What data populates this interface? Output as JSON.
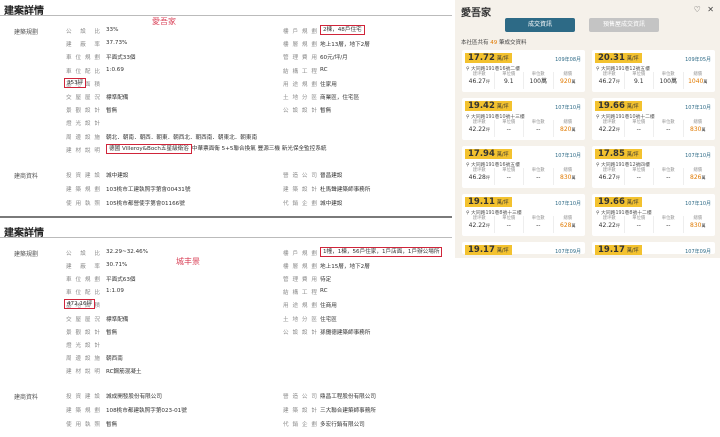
{
  "section1": {
    "title": "建案詳情",
    "group_plan": "建築規劃",
    "group_info": "建商資料",
    "watermark": "愛吾家",
    "left_rows": [
      {
        "label": "公設比",
        "value": "33%"
      },
      {
        "label": "建蔽率",
        "value": "37.73%"
      },
      {
        "label": "車位規劃",
        "value": "平面式33個"
      },
      {
        "label": "車位配比",
        "value": "1:0.69"
      },
      {
        "label": "基地面積",
        "value": "353坪",
        "highlight": true
      },
      {
        "label": "交屋屋況",
        "value": "標準配備"
      },
      {
        "label": "景觀設計",
        "value": "暫無"
      },
      {
        "label": "燈光設計",
        "value": ""
      },
      {
        "label": "周邊設施",
        "value": "朝北．朝南．朝西．朝東．朝西北．朝西南．朝東北．朝東南"
      },
      {
        "label": "建材說明",
        "value": "德國 Villeroy&Boch五星級衛浴",
        "highlight": true,
        "extra": "中華票面衛 5+5聯合換氣 豐源三機 新光保全監控系統"
      }
    ],
    "right_rows": [
      {
        "label": "樓戶規劃",
        "value": "2棟，48戶住宅",
        "highlight": true
      },
      {
        "label": "樓層規劃",
        "value": "地上13層，地下2層"
      },
      {
        "label": "管理費用",
        "value": "60元/坪/月"
      },
      {
        "label": "結構工程",
        "value": "RC"
      },
      {
        "label": "用途規劃",
        "value": "住家用"
      },
      {
        "label": "土地分區",
        "value": "商業區，住宅區"
      },
      {
        "label": "公設設計",
        "value": "暫無"
      }
    ],
    "info_left": [
      {
        "label": "投資建設",
        "value": "城中建設"
      },
      {
        "label": "建築規劃",
        "value": "103桃市工建執照字第會00431號"
      },
      {
        "label": "使用執照",
        "value": "105桃市都營使字第會01166號"
      }
    ],
    "info_right": [
      {
        "label": "營造公司",
        "value": "晉昌建設"
      },
      {
        "label": "建築設計",
        "value": "杜馬聲建築師事務所"
      },
      {
        "label": "代銷企劃",
        "value": "城中建設"
      }
    ]
  },
  "section2": {
    "title": "建案詳情",
    "group_plan": "建築規劃",
    "group_info": "建商資料",
    "watermark": "城丰景",
    "left_rows": [
      {
        "label": "公設比",
        "value": "32.29~32.46%"
      },
      {
        "label": "建蔽率",
        "value": "30.71%"
      },
      {
        "label": "車位規劃",
        "value": "平面式63個"
      },
      {
        "label": "車位配比",
        "value": "1:1.09"
      },
      {
        "label": "基地面積",
        "value": "472.16坪",
        "highlight": true
      },
      {
        "label": "交屋屋況",
        "value": "標準配備"
      },
      {
        "label": "景觀設計",
        "value": "暫無"
      },
      {
        "label": "燈光設計",
        "value": ""
      },
      {
        "label": "周邊設施",
        "value": "朝西南"
      },
      {
        "label": "建材說明",
        "value": "RC鋼筋混凝土"
      }
    ],
    "right_rows": [
      {
        "label": "樓戶規劃",
        "value": "1幢，1棟，56戶住家，1戶店面，1戶辦公場所",
        "highlight": true
      },
      {
        "label": "樓層規劃",
        "value": "地上15層，地下2層"
      },
      {
        "label": "管理費用",
        "value": "待定"
      },
      {
        "label": "結構工程",
        "value": "RC"
      },
      {
        "label": "用途規劃",
        "value": "住商用"
      },
      {
        "label": "土地分區",
        "value": "住宅區"
      },
      {
        "label": "公設設計",
        "value": "孫攤德建築師事務所"
      }
    ],
    "info_left": [
      {
        "label": "投資建設",
        "value": "城成開發股份有限公司"
      },
      {
        "label": "建築規劃",
        "value": "108桃市都建執照字第023-01號"
      },
      {
        "label": "使用執照",
        "value": "暫無"
      }
    ],
    "info_right": [
      {
        "label": "營造公司",
        "value": "鼎昌工程股份有限公司"
      },
      {
        "label": "建築設計",
        "value": "三大聯合建築師事務所"
      },
      {
        "label": "代銷企劃",
        "value": "多宏行銷有限公司"
      }
    ]
  },
  "side": {
    "brand": "愛吾家",
    "icon_heart": "♡",
    "icon_close": "✕",
    "tab_active": "成交資訊",
    "tab_inactive": "預售屋成交資訊",
    "count_prefix": "本社區共有 ",
    "count_num": "49",
    "count_suffix": " 筆成交資料",
    "stat_labels": [
      "建坪數",
      "單位價",
      "車位數",
      "總價"
    ],
    "unit": "萬/坪",
    "cards": [
      {
        "price": "17.72",
        "date": "109年08月",
        "addr": "大同路191巷16號二樓",
        "area": "46.27",
        "unit_price": "9.1",
        "parking": "100萬",
        "total": "920"
      },
      {
        "price": "20.31",
        "date": "109年05月",
        "addr": "大同路191巷12號五樓",
        "area": "46.27",
        "unit_price": "9.1",
        "parking": "100萬",
        "total": "1040"
      },
      {
        "price": "19.42",
        "date": "107年10月",
        "addr": "大同路191巷10號十三樓",
        "area": "42.22",
        "unit_price": "--",
        "parking": "--",
        "total": "820"
      },
      {
        "price": "19.66",
        "date": "107年10月",
        "addr": "大同路191巷10號十二樓",
        "area": "42.22",
        "unit_price": "--",
        "parking": "--",
        "total": "830"
      },
      {
        "price": "17.94",
        "date": "107年10月",
        "addr": "大同路191巷16號五樓",
        "area": "46.28",
        "unit_price": "--",
        "parking": "--",
        "total": "830"
      },
      {
        "price": "17.85",
        "date": "107年10月",
        "addr": "大同路191巷12號四樓",
        "area": "46.27",
        "unit_price": "--",
        "parking": "--",
        "total": "826"
      },
      {
        "price": "19.11",
        "date": "107年10月",
        "addr": "大同路191巷8號十三樓",
        "area": "42.22",
        "unit_price": "--",
        "parking": "--",
        "total": "628"
      },
      {
        "price": "19.66",
        "date": "107年10月",
        "addr": "大同路191巷8號十二樓",
        "area": "42.22",
        "unit_price": "--",
        "parking": "--",
        "total": "830"
      },
      {
        "price": "19.17",
        "date": "107年09月"
      },
      {
        "price": "19.17",
        "date": "107年09月"
      }
    ]
  }
}
